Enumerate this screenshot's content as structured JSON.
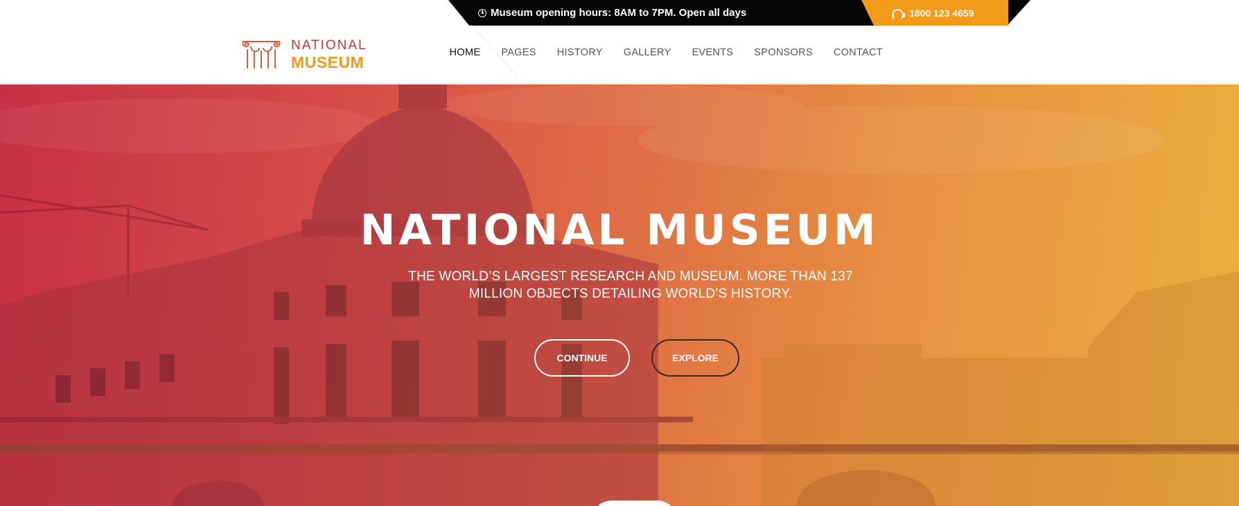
{
  "topbar": {
    "hours_text": "Museum opening hours: 8AM to 7PM. Open all days",
    "phone": "1800 123 4659"
  },
  "logo": {
    "line1": "NATIONAL",
    "line2": "MUSEUM"
  },
  "nav": {
    "items": [
      {
        "label": "HOME",
        "active": true
      },
      {
        "label": "PAGES"
      },
      {
        "label": "HISTORY"
      },
      {
        "label": "GALLERY"
      },
      {
        "label": "EVENTS"
      },
      {
        "label": "SPONSORS"
      },
      {
        "label": "CONTACT"
      }
    ]
  },
  "hero": {
    "title": "NATIONAL MUSEUM",
    "subtitle": "THE WORLD’S LARGEST RESEARCH AND MUSEUM. MORE THAN 137 MILLION OBJECTS DETAILING WORLD’S HISTORY.",
    "continue_label": "CONTINUE",
    "explore_label": "EXPLORE"
  },
  "colors": {
    "brand_red": "#d6323f",
    "brand_orange": "#f39a1b",
    "topbar_dark": "#050505"
  },
  "icons": [
    "clock-icon",
    "headset-icon",
    "museum-pillar-logo-icon"
  ]
}
